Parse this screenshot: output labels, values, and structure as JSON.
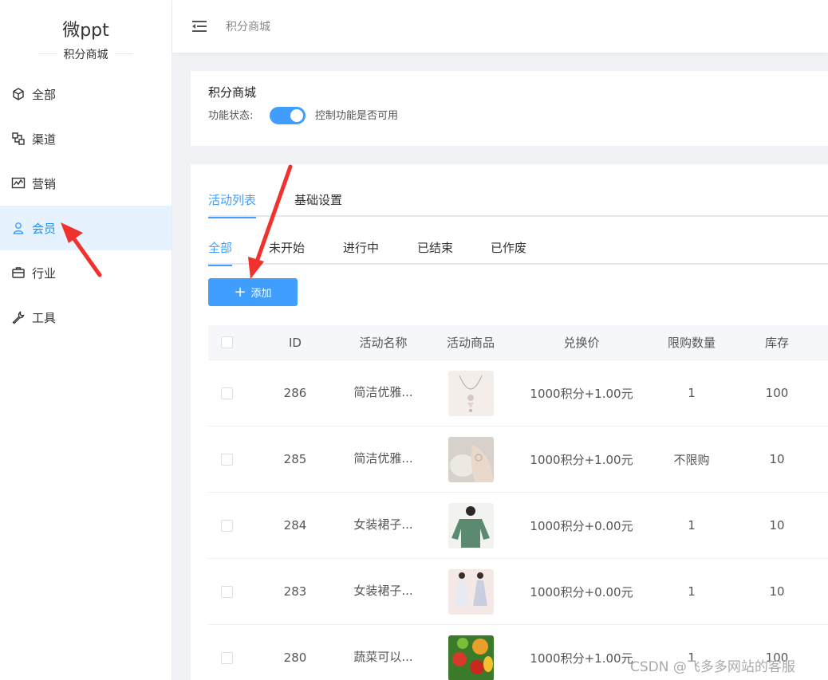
{
  "brand": {
    "title": "微ppt",
    "subtitle": "积分商城"
  },
  "nav": {
    "items": [
      {
        "label": "全部",
        "icon": "cube-icon"
      },
      {
        "label": "渠道",
        "icon": "channel-icon"
      },
      {
        "label": "营销",
        "icon": "chart-icon"
      },
      {
        "label": "会员",
        "icon": "user-icon",
        "active": true
      },
      {
        "label": "行业",
        "icon": "briefcase-icon"
      },
      {
        "label": "工具",
        "icon": "wrench-icon"
      }
    ]
  },
  "header": {
    "breadcrumb": "积分商城"
  },
  "feature": {
    "title": "积分商城",
    "status_label": "功能状态:",
    "status_on": true,
    "status_desc": "控制功能是否可用"
  },
  "tabs": {
    "main": [
      "活动列表",
      "基础设置"
    ],
    "sub": [
      "全部",
      "未开始",
      "进行中",
      "已结束",
      "已作废"
    ]
  },
  "toolbar": {
    "add_label": "添加"
  },
  "table": {
    "headers": {
      "id": "ID",
      "name": "活动名称",
      "image": "活动商品",
      "price": "兑换价",
      "limit": "限购数量",
      "stock": "库存"
    },
    "rows": [
      {
        "id": "286",
        "name": "简洁优雅...",
        "price": "1000积分+1.00元",
        "limit": "1",
        "stock": "100"
      },
      {
        "id": "285",
        "name": "简洁优雅...",
        "price": "1000积分+1.00元",
        "limit": "不限购",
        "stock": "10"
      },
      {
        "id": "284",
        "name": "女装裙子...",
        "price": "1000积分+0.00元",
        "limit": "1",
        "stock": "10"
      },
      {
        "id": "283",
        "name": "女装裙子...",
        "price": "1000积分+0.00元",
        "limit": "1",
        "stock": "10"
      },
      {
        "id": "280",
        "name": "蔬菜可以...",
        "price": "1000积分+1.00元",
        "limit": "1",
        "stock": "100"
      }
    ]
  },
  "watermark": "CSDN @飞多多网站的客服",
  "colors": {
    "primary": "#409eff",
    "active_bg": "#e6f2fd",
    "arrow": "#f0312c"
  }
}
